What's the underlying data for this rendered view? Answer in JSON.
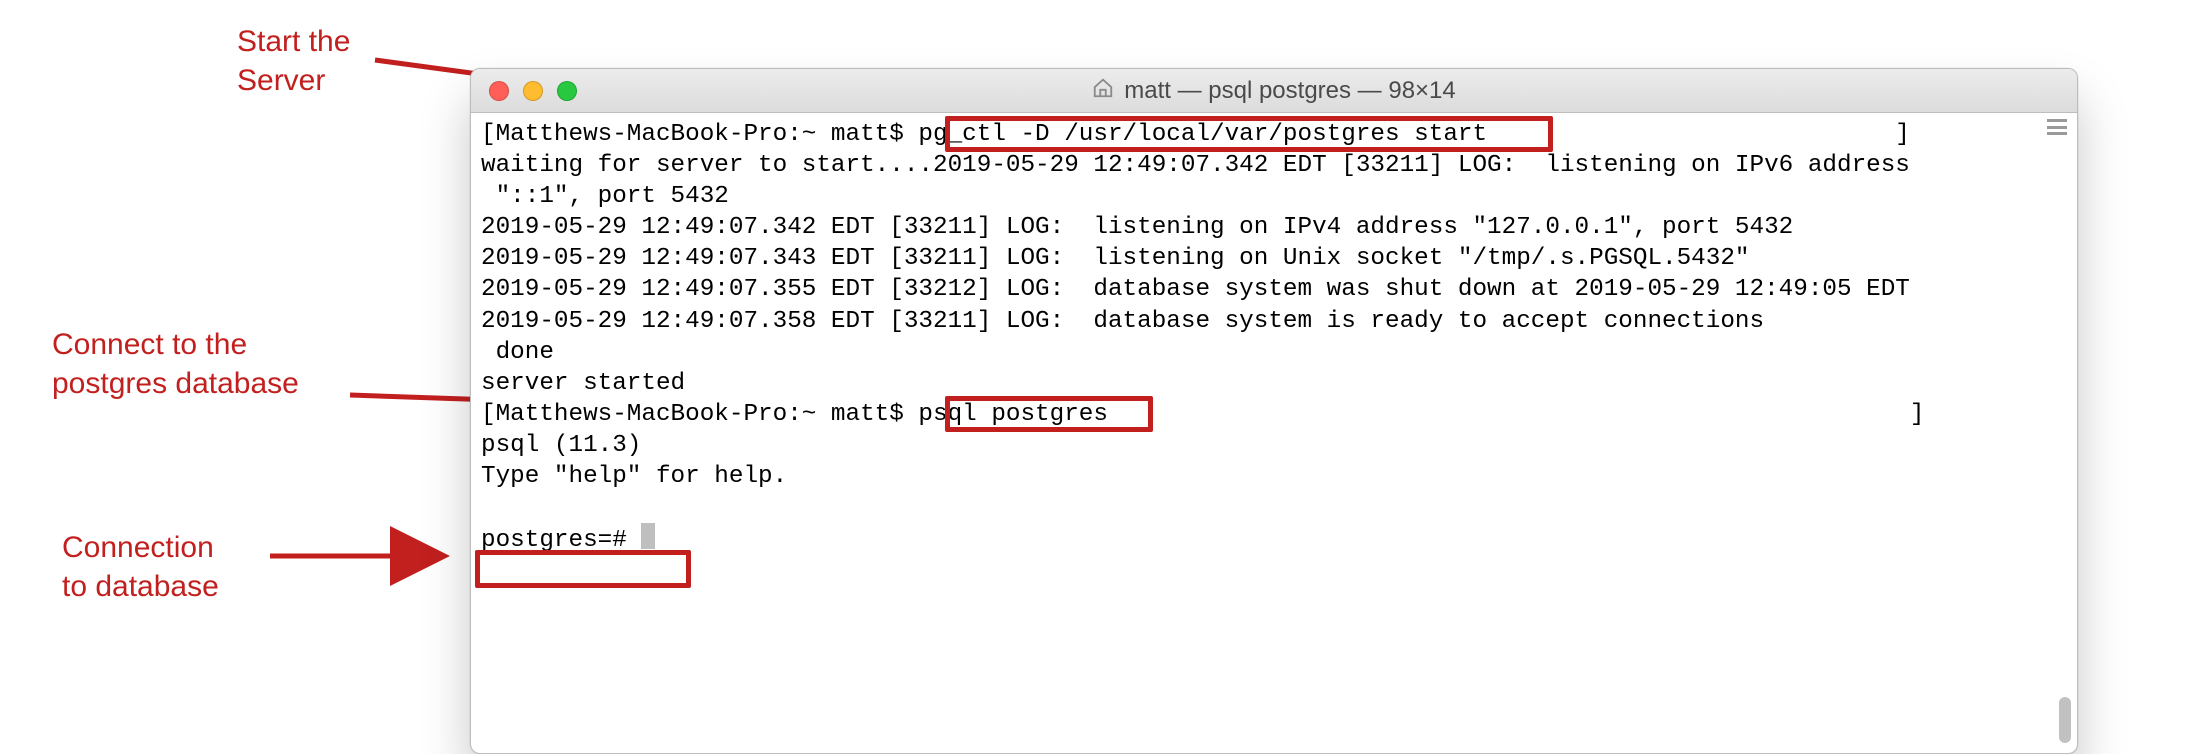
{
  "annotations": {
    "a1_l1": "Start the",
    "a1_l2": "Server",
    "a2_l1": "Connect to the",
    "a2_l2": "postgres database",
    "a3_l1": "Connection",
    "a3_l2": "to database"
  },
  "window": {
    "title": "matt — psql postgres — 98×14"
  },
  "terminal": {
    "line01": "[Matthews-MacBook-Pro:~ matt$ pg_ctl -D /usr/local/var/postgres start                            ]",
    "line02": "waiting for server to start....2019-05-29 12:49:07.342 EDT [33211] LOG:  listening on IPv6 address",
    "line03": " \"::1\", port 5432",
    "line04": "2019-05-29 12:49:07.342 EDT [33211] LOG:  listening on IPv4 address \"127.0.0.1\", port 5432",
    "line05": "2019-05-29 12:49:07.343 EDT [33211] LOG:  listening on Unix socket \"/tmp/.s.PGSQL.5432\"",
    "line06": "2019-05-29 12:49:07.355 EDT [33212] LOG:  database system was shut down at 2019-05-29 12:49:05 EDT",
    "line07": "2019-05-29 12:49:07.358 EDT [33211] LOG:  database system is ready to accept connections",
    "line08": " done",
    "line09": "server started",
    "line10": "[Matthews-MacBook-Pro:~ matt$ psql postgres                                                       ]",
    "line11": "psql (11.3)",
    "line12": "Type \"help\" for help.",
    "line13": "",
    "prompt": "postgres=# "
  }
}
